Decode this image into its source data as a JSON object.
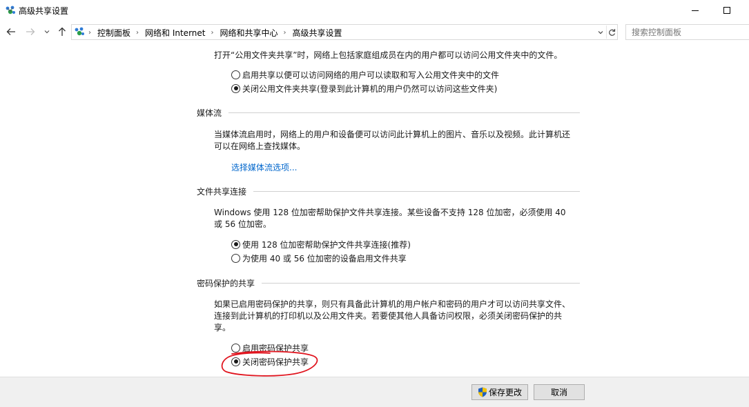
{
  "window": {
    "title": "高级共享设置"
  },
  "navigation": {
    "breadcrumbs": [
      "控制面板",
      "网络和 Internet",
      "网络和共享中心",
      "高级共享设置"
    ],
    "search_placeholder": "搜索控制面板"
  },
  "public_folder": {
    "description": "打开“公用文件夹共享”时，网络上包括家庭组成员在内的用户都可以访问公用文件夹中的文件。",
    "options": [
      {
        "label": "启用共享以便可以访问网络的用户可以读取和写入公用文件夹中的文件",
        "checked": false
      },
      {
        "label": "关闭公用文件夹共享(登录到此计算机的用户仍然可以访问这些文件夹)",
        "checked": true
      }
    ]
  },
  "media_streaming": {
    "heading": "媒体流",
    "description": "当媒体流启用时，网络上的用户和设备便可以访问此计算机上的图片、音乐以及视频。此计算机还可以在网络上查找媒体。",
    "link": "选择媒体流选项..."
  },
  "file_sharing": {
    "heading": "文件共享连接",
    "description": "Windows 使用 128 位加密帮助保护文件共享连接。某些设备不支持 128 位加密，必须使用 40 或 56 位加密。",
    "options": [
      {
        "label": "使用 128 位加密帮助保护文件共享连接(推荐)",
        "checked": true
      },
      {
        "label": "为使用 40 或 56 位加密的设备启用文件共享",
        "checked": false
      }
    ]
  },
  "password_sharing": {
    "heading": "密码保护的共享",
    "description": "如果已启用密码保护的共享，则只有具备此计算机的用户帐户和密码的用户才可以访问共享文件、连接到此计算机的打印机以及公用文件夹。若要使其他人具备访问权限，必须关闭密码保护的共享。",
    "options": [
      {
        "label": "启用密码保护共享",
        "checked": false
      },
      {
        "label": "关闭密码保护共享",
        "checked": true
      }
    ]
  },
  "footer": {
    "save_label": "保存更改",
    "cancel_label": "取消"
  },
  "colors": {
    "link": "#0066cc",
    "annotation": "#e0141e",
    "shield_blue": "#1f5fbf",
    "shield_yellow": "#f2c200"
  },
  "icons": {
    "app": "network-icon",
    "back": "arrow-left-icon",
    "forward": "arrow-right-icon",
    "recent": "chevron-down-icon",
    "up": "arrow-up-icon",
    "refresh": "refresh-icon",
    "save": "uac-shield-icon"
  }
}
